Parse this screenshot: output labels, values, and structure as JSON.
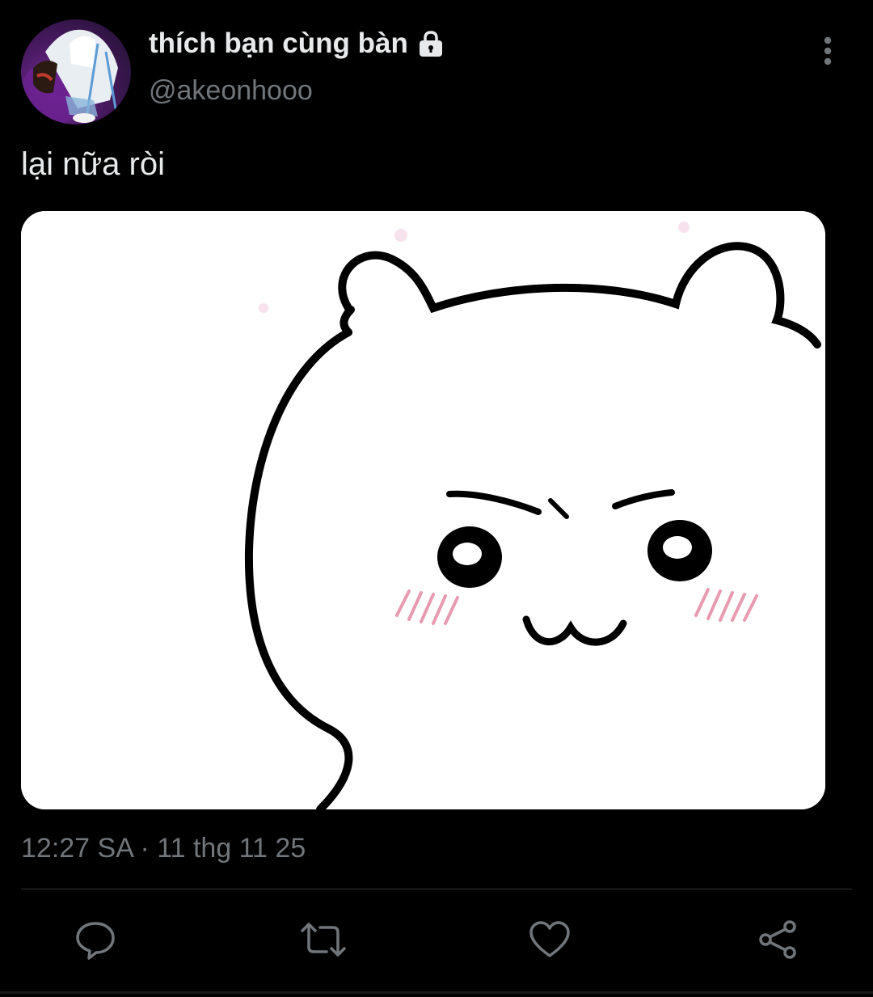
{
  "tweet": {
    "author": {
      "display_name": "thích bạn cùng bàn",
      "handle": "@akeonhooo",
      "protected_icon": "lock-icon",
      "avatar": "profile-avatar"
    },
    "text": "lại nữa ròi",
    "media": {
      "type": "image",
      "icon": "meme-image"
    },
    "timestamp": "12:27 SA · 11 thg 11 25"
  },
  "actions": [
    {
      "name": "reply",
      "icon": "reply-icon"
    },
    {
      "name": "retweet",
      "icon": "retweet-icon"
    },
    {
      "name": "like",
      "icon": "heart-icon"
    },
    {
      "name": "share",
      "icon": "share-icon"
    }
  ],
  "colors": {
    "background": "#000000",
    "primary_text": "#e7e9ea",
    "secondary_text": "#71767b",
    "divider": "#2f3336"
  }
}
